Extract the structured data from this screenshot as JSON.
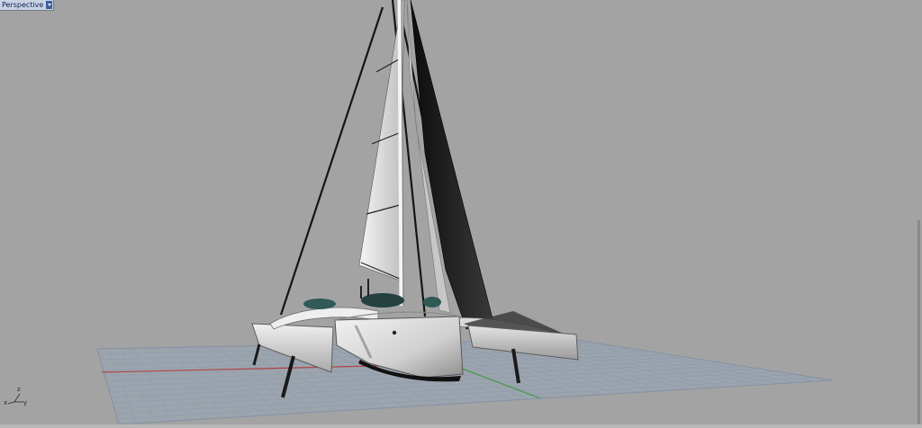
{
  "viewport": {
    "name": "Perspective",
    "menu_icon": "chevron-down-icon"
  },
  "axes": {
    "x_label": "x",
    "y_label": "y",
    "z_label": "z",
    "x_color": "#b04545",
    "y_color": "#3f9a3f"
  },
  "colors": {
    "background": "#a3a3a3",
    "grid_line": "#8f9fb2",
    "grid_fill": "#9ca4ad",
    "hull": "#e2e2e2",
    "sail_dark": "#111111",
    "glass": "#2f5a57"
  }
}
